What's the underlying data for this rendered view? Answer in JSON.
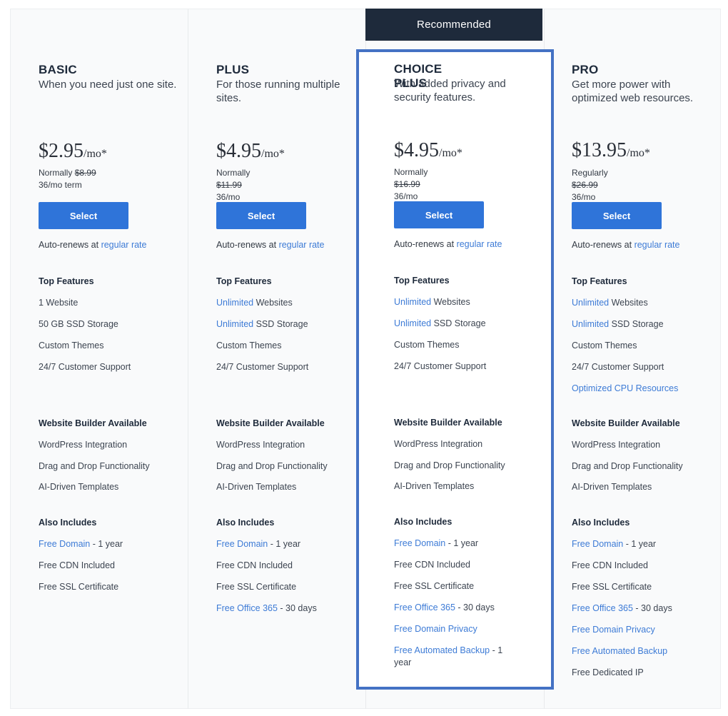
{
  "recommended_label": "Recommended",
  "colors": {
    "accent": "#2f74d9",
    "link": "#3d7bd6",
    "highlight_border": "#4472c4",
    "banner_bg": "#1e2a3b"
  },
  "plans": [
    {
      "name": "BASIC",
      "description": "When you need just one site.",
      "price": "$2.95",
      "per": "/mo*",
      "regular_prefix": "Normally",
      "regular_price": "$8.99",
      "term": "36/mo term",
      "select_label": "Select",
      "autorenew_prefix": "Auto-renews at",
      "autorenew_link": "regular rate",
      "top_features_title": "Top Features",
      "top_features": [
        {
          "link": "",
          "text": "1 Website"
        },
        {
          "link": "",
          "text": "50 GB SSD Storage"
        },
        {
          "link": "",
          "text": "Custom Themes"
        },
        {
          "link": "",
          "text": "24/7 Customer Support"
        }
      ],
      "builder_title": "Website Builder Available",
      "builder_features": [
        "WordPress Integration",
        "Drag and Drop Functionality",
        "AI-Driven Templates"
      ],
      "also_title": "Also Includes",
      "also_includes": [
        {
          "link": "Free Domain",
          "text": " - 1 year"
        },
        {
          "link": "",
          "text": "Free CDN Included"
        },
        {
          "link": "",
          "text": "Free SSL Certificate"
        }
      ]
    },
    {
      "name": "PLUS",
      "description": "For those running multiple sites.",
      "price": "$4.95",
      "per": "/mo*",
      "regular_prefix": "Normally",
      "regular_price": "$11.99",
      "term": "36/mo term",
      "select_label": "Select",
      "autorenew_prefix": "Auto-renews at",
      "autorenew_link": "regular rate",
      "top_features_title": "Top Features",
      "top_features": [
        {
          "link": "Unlimited",
          "text": " Websites"
        },
        {
          "link": "Unlimited",
          "text": " SSD Storage"
        },
        {
          "link": "",
          "text": "Custom Themes"
        },
        {
          "link": "",
          "text": "24/7 Customer Support"
        }
      ],
      "builder_title": "Website Builder Available",
      "builder_features": [
        "WordPress Integration",
        "Drag and Drop Functionality",
        "AI-Driven Templates"
      ],
      "also_title": "Also Includes",
      "also_includes": [
        {
          "link": "Free Domain",
          "text": " - 1 year"
        },
        {
          "link": "",
          "text": "Free CDN Included"
        },
        {
          "link": "",
          "text": "Free SSL Certificate"
        },
        {
          "link": "Free Office 365",
          "text": " - 30 days"
        }
      ]
    },
    {
      "name": "CHOICE PLUS",
      "description": "With added privacy and security features.",
      "price": "$4.95",
      "per": "/mo*",
      "regular_prefix": "Normally",
      "regular_price": "$16.99",
      "term": "36/mo term",
      "select_label": "Select",
      "autorenew_prefix": "Auto-renews at",
      "autorenew_link": "regular rate",
      "top_features_title": "Top Features",
      "top_features": [
        {
          "link": "Unlimited",
          "text": " Websites"
        },
        {
          "link": "Unlimited",
          "text": " SSD Storage"
        },
        {
          "link": "",
          "text": "Custom Themes"
        },
        {
          "link": "",
          "text": "24/7 Customer Support"
        }
      ],
      "builder_title": "Website Builder Available",
      "builder_features": [
        "WordPress Integration",
        "Drag and Drop Functionality",
        "AI-Driven Templates"
      ],
      "also_title": "Also Includes",
      "also_includes": [
        {
          "link": "Free Domain",
          "text": " - 1 year"
        },
        {
          "link": "",
          "text": "Free CDN Included"
        },
        {
          "link": "",
          "text": "Free SSL Certificate"
        },
        {
          "link": "Free Office 365",
          "text": " - 30 days"
        },
        {
          "link": "Free Domain Privacy",
          "text": ""
        },
        {
          "link": "Free Automated Backup",
          "text": " - 1 year"
        }
      ]
    },
    {
      "name": "PRO",
      "description": "Get more power with optimized web resources.",
      "price": "$13.95",
      "per": "/mo*",
      "regular_prefix": "Regularly",
      "regular_price": "$26.99",
      "term": "36/mo term",
      "select_label": "Select",
      "autorenew_prefix": "Auto-renews at",
      "autorenew_link": "regular rate",
      "top_features_title": "Top Features",
      "top_features": [
        {
          "link": "Unlimited",
          "text": " Websites"
        },
        {
          "link": "Unlimited",
          "text": " SSD Storage"
        },
        {
          "link": "",
          "text": "Custom Themes"
        },
        {
          "link": "",
          "text": "24/7 Customer Support"
        },
        {
          "link": "Optimized CPU Resources",
          "text": ""
        }
      ],
      "builder_title": "Website Builder Available",
      "builder_features": [
        "WordPress Integration",
        "Drag and Drop Functionality",
        "AI-Driven Templates"
      ],
      "also_title": "Also Includes",
      "also_includes": [
        {
          "link": "Free Domain",
          "text": " - 1 year"
        },
        {
          "link": "",
          "text": "Free CDN Included"
        },
        {
          "link": "",
          "text": "Free SSL Certificate"
        },
        {
          "link": "Free Office 365",
          "text": " - 30 days"
        },
        {
          "link": "Free Domain Privacy",
          "text": ""
        },
        {
          "link": "Free Automated Backup",
          "text": ""
        },
        {
          "link": "",
          "text": "Free Dedicated IP"
        }
      ]
    }
  ]
}
